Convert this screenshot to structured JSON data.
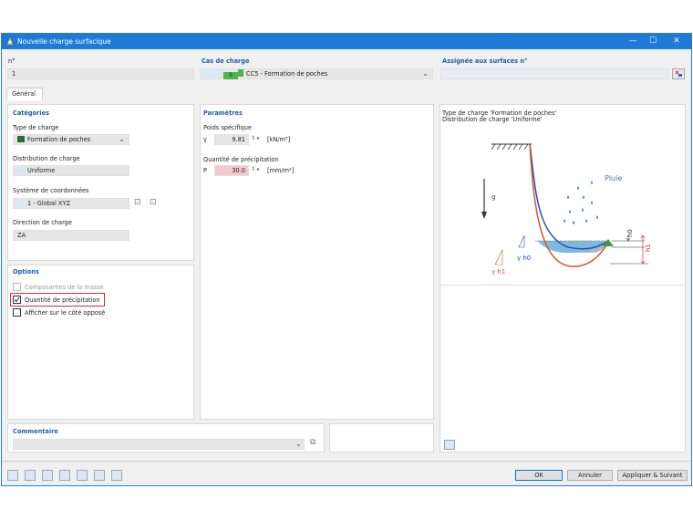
{
  "title": "Nouvelle charge surfacique",
  "number": {
    "label": "n°",
    "value": "1"
  },
  "load_case": {
    "label": "Cas de charge",
    "code": "S",
    "value": "CC5 - Formation de poches",
    "color": "#4ab84a"
  },
  "assigned": {
    "label": "Assignée aux surfaces n°",
    "value": ""
  },
  "tab_general": "Général",
  "categories": {
    "header": "Catégories",
    "load_type_label": "Type de charge",
    "load_type_value": "Formation de poches",
    "load_type_color": "#2e6b2e",
    "distribution_label": "Distribution de charge",
    "distribution_value": "Uniforme",
    "coord_label": "Système de coordonnées",
    "coord_value": "1 - Global XYZ",
    "direction_label": "Direction de charge",
    "direction_value": "ZA"
  },
  "parameters": {
    "header": "Paramètres",
    "weight_label": "Poids spécifique",
    "gamma_symbol": "γ",
    "gamma_value": "9.81",
    "gamma_unit": "[kN/m³]",
    "precip_label": "Quantité de précipitation",
    "p_symbol": "P",
    "p_value": "30.0",
    "p_unit": "[mm/m²]"
  },
  "options": {
    "header": "Options",
    "mass_components": "Composantes de la masse",
    "precip_quantity": "Quantité de précipitation",
    "show_opposite": "Afficher sur le côté opposé"
  },
  "diagram": {
    "line1": "Type de charge 'Formation de poches'",
    "line2": "Distribution de charge 'Uniforme'",
    "rain_label": "Pluie",
    "g_label": "g",
    "h0": "h0",
    "h1": "h1",
    "gh0": "γ h0",
    "gh1": "γ h1"
  },
  "comment": {
    "label": "Commentaire",
    "value": ""
  },
  "buttons": {
    "ok": "OK",
    "cancel": "Annuler",
    "apply_next": "Appliquer & Suivant"
  }
}
